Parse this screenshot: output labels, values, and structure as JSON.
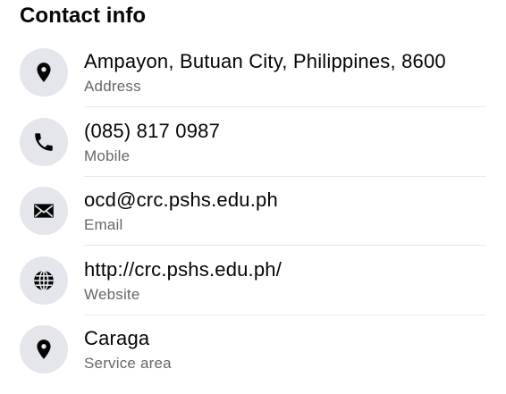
{
  "section": {
    "title": "Contact info"
  },
  "items": [
    {
      "icon": "location-pin-icon",
      "primary": "Ampayon, Butuan City, Philippines, 8600",
      "secondary": "Address"
    },
    {
      "icon": "phone-icon",
      "primary": "(085) 817 0987",
      "secondary": "Mobile"
    },
    {
      "icon": "envelope-icon",
      "primary": "ocd@crc.pshs.edu.ph",
      "secondary": "Email"
    },
    {
      "icon": "globe-icon",
      "primary": "http://crc.pshs.edu.ph/",
      "secondary": "Website"
    },
    {
      "icon": "location-pin-icon",
      "primary": "Caraga",
      "secondary": "Service area"
    }
  ],
  "colors": {
    "icon_bg": "#e4e6eb",
    "primary_text": "#050505",
    "secondary_text": "#65676b",
    "divider": "#e8e9ec"
  }
}
